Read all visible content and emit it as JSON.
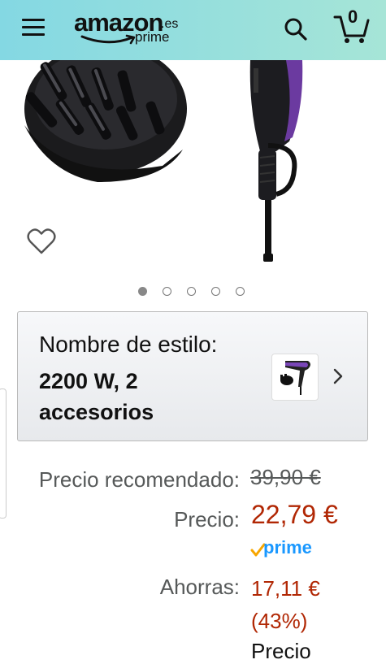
{
  "header": {
    "logo_text": "amazon",
    "logo_tld": ".es",
    "logo_prime": "prime",
    "cart_count": "0"
  },
  "gallery": {
    "image_count": 5,
    "active_index": 0
  },
  "style": {
    "label": "Nombre de estilo:",
    "value": "2200 W, 2 accesorios"
  },
  "pricing": {
    "list_price_label": "Precio recomendado:",
    "list_price": "39,90 €",
    "price_label": "Precio:",
    "price": "22,79 €",
    "prime_badge": "prime",
    "savings_label": "Ahorras:",
    "savings_amount": "17,11 €",
    "savings_percent": "(43%)",
    "next_label_partial": "Precio"
  },
  "colors": {
    "header_start": "#84d8e3",
    "header_end": "#a6e5d7",
    "price_red": "#b12704",
    "prime_blue": "#1a98ff",
    "prime_check": "#f7a600"
  }
}
